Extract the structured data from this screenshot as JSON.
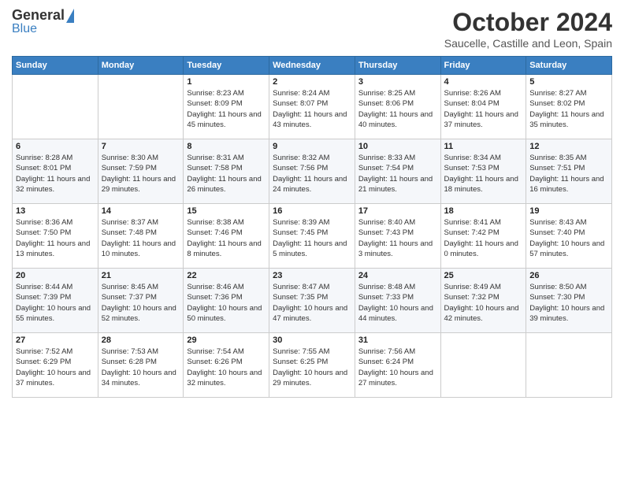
{
  "logo": {
    "general": "General",
    "blue": "Blue"
  },
  "title": "October 2024",
  "subtitle": "Saucelle, Castille and Leon, Spain",
  "days_of_week": [
    "Sunday",
    "Monday",
    "Tuesday",
    "Wednesday",
    "Thursday",
    "Friday",
    "Saturday"
  ],
  "weeks": [
    [
      {
        "num": "",
        "detail": ""
      },
      {
        "num": "",
        "detail": ""
      },
      {
        "num": "1",
        "detail": "Sunrise: 8:23 AM\nSunset: 8:09 PM\nDaylight: 11 hours and 45 minutes."
      },
      {
        "num": "2",
        "detail": "Sunrise: 8:24 AM\nSunset: 8:07 PM\nDaylight: 11 hours and 43 minutes."
      },
      {
        "num": "3",
        "detail": "Sunrise: 8:25 AM\nSunset: 8:06 PM\nDaylight: 11 hours and 40 minutes."
      },
      {
        "num": "4",
        "detail": "Sunrise: 8:26 AM\nSunset: 8:04 PM\nDaylight: 11 hours and 37 minutes."
      },
      {
        "num": "5",
        "detail": "Sunrise: 8:27 AM\nSunset: 8:02 PM\nDaylight: 11 hours and 35 minutes."
      }
    ],
    [
      {
        "num": "6",
        "detail": "Sunrise: 8:28 AM\nSunset: 8:01 PM\nDaylight: 11 hours and 32 minutes."
      },
      {
        "num": "7",
        "detail": "Sunrise: 8:30 AM\nSunset: 7:59 PM\nDaylight: 11 hours and 29 minutes."
      },
      {
        "num": "8",
        "detail": "Sunrise: 8:31 AM\nSunset: 7:58 PM\nDaylight: 11 hours and 26 minutes."
      },
      {
        "num": "9",
        "detail": "Sunrise: 8:32 AM\nSunset: 7:56 PM\nDaylight: 11 hours and 24 minutes."
      },
      {
        "num": "10",
        "detail": "Sunrise: 8:33 AM\nSunset: 7:54 PM\nDaylight: 11 hours and 21 minutes."
      },
      {
        "num": "11",
        "detail": "Sunrise: 8:34 AM\nSunset: 7:53 PM\nDaylight: 11 hours and 18 minutes."
      },
      {
        "num": "12",
        "detail": "Sunrise: 8:35 AM\nSunset: 7:51 PM\nDaylight: 11 hours and 16 minutes."
      }
    ],
    [
      {
        "num": "13",
        "detail": "Sunrise: 8:36 AM\nSunset: 7:50 PM\nDaylight: 11 hours and 13 minutes."
      },
      {
        "num": "14",
        "detail": "Sunrise: 8:37 AM\nSunset: 7:48 PM\nDaylight: 11 hours and 10 minutes."
      },
      {
        "num": "15",
        "detail": "Sunrise: 8:38 AM\nSunset: 7:46 PM\nDaylight: 11 hours and 8 minutes."
      },
      {
        "num": "16",
        "detail": "Sunrise: 8:39 AM\nSunset: 7:45 PM\nDaylight: 11 hours and 5 minutes."
      },
      {
        "num": "17",
        "detail": "Sunrise: 8:40 AM\nSunset: 7:43 PM\nDaylight: 11 hours and 3 minutes."
      },
      {
        "num": "18",
        "detail": "Sunrise: 8:41 AM\nSunset: 7:42 PM\nDaylight: 11 hours and 0 minutes."
      },
      {
        "num": "19",
        "detail": "Sunrise: 8:43 AM\nSunset: 7:40 PM\nDaylight: 10 hours and 57 minutes."
      }
    ],
    [
      {
        "num": "20",
        "detail": "Sunrise: 8:44 AM\nSunset: 7:39 PM\nDaylight: 10 hours and 55 minutes."
      },
      {
        "num": "21",
        "detail": "Sunrise: 8:45 AM\nSunset: 7:37 PM\nDaylight: 10 hours and 52 minutes."
      },
      {
        "num": "22",
        "detail": "Sunrise: 8:46 AM\nSunset: 7:36 PM\nDaylight: 10 hours and 50 minutes."
      },
      {
        "num": "23",
        "detail": "Sunrise: 8:47 AM\nSunset: 7:35 PM\nDaylight: 10 hours and 47 minutes."
      },
      {
        "num": "24",
        "detail": "Sunrise: 8:48 AM\nSunset: 7:33 PM\nDaylight: 10 hours and 44 minutes."
      },
      {
        "num": "25",
        "detail": "Sunrise: 8:49 AM\nSunset: 7:32 PM\nDaylight: 10 hours and 42 minutes."
      },
      {
        "num": "26",
        "detail": "Sunrise: 8:50 AM\nSunset: 7:30 PM\nDaylight: 10 hours and 39 minutes."
      }
    ],
    [
      {
        "num": "27",
        "detail": "Sunrise: 7:52 AM\nSunset: 6:29 PM\nDaylight: 10 hours and 37 minutes."
      },
      {
        "num": "28",
        "detail": "Sunrise: 7:53 AM\nSunset: 6:28 PM\nDaylight: 10 hours and 34 minutes."
      },
      {
        "num": "29",
        "detail": "Sunrise: 7:54 AM\nSunset: 6:26 PM\nDaylight: 10 hours and 32 minutes."
      },
      {
        "num": "30",
        "detail": "Sunrise: 7:55 AM\nSunset: 6:25 PM\nDaylight: 10 hours and 29 minutes."
      },
      {
        "num": "31",
        "detail": "Sunrise: 7:56 AM\nSunset: 6:24 PM\nDaylight: 10 hours and 27 minutes."
      },
      {
        "num": "",
        "detail": ""
      },
      {
        "num": "",
        "detail": ""
      }
    ]
  ]
}
